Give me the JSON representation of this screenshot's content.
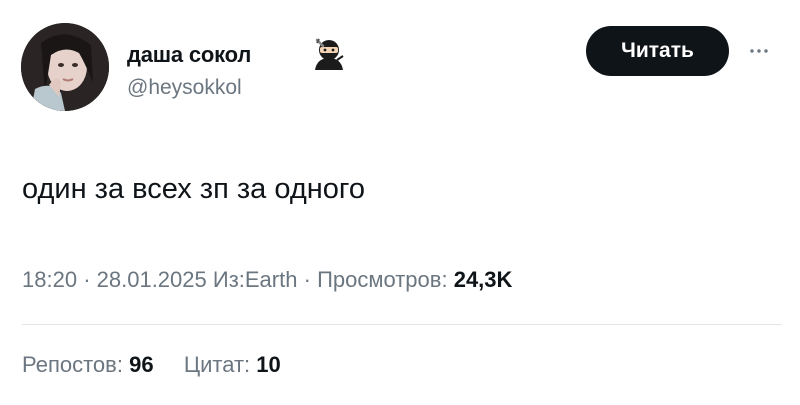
{
  "author": {
    "display_name": "даша сокол",
    "handle": "@heysokkol",
    "emoji_icon": "ninja-emoji-icon"
  },
  "follow_button": {
    "label": "Читать"
  },
  "more_button": {
    "icon": "more-horizontal-icon"
  },
  "tweet": {
    "text": "один за всех зп за одного"
  },
  "meta": {
    "time": "18:20",
    "separator": "·",
    "date": "28.01.2025",
    "source": "Из:Earth",
    "views_label": "Просмотров:",
    "views_count": "24,3K"
  },
  "stats": {
    "reposts_label": "Репостов:",
    "reposts_count": "96",
    "quotes_label": "Цитат:",
    "quotes_count": "10"
  },
  "colors": {
    "text_primary": "#0f1419",
    "text_secondary": "#6b7680",
    "button_bg": "#0f1419",
    "divider": "#e3e6e9"
  }
}
